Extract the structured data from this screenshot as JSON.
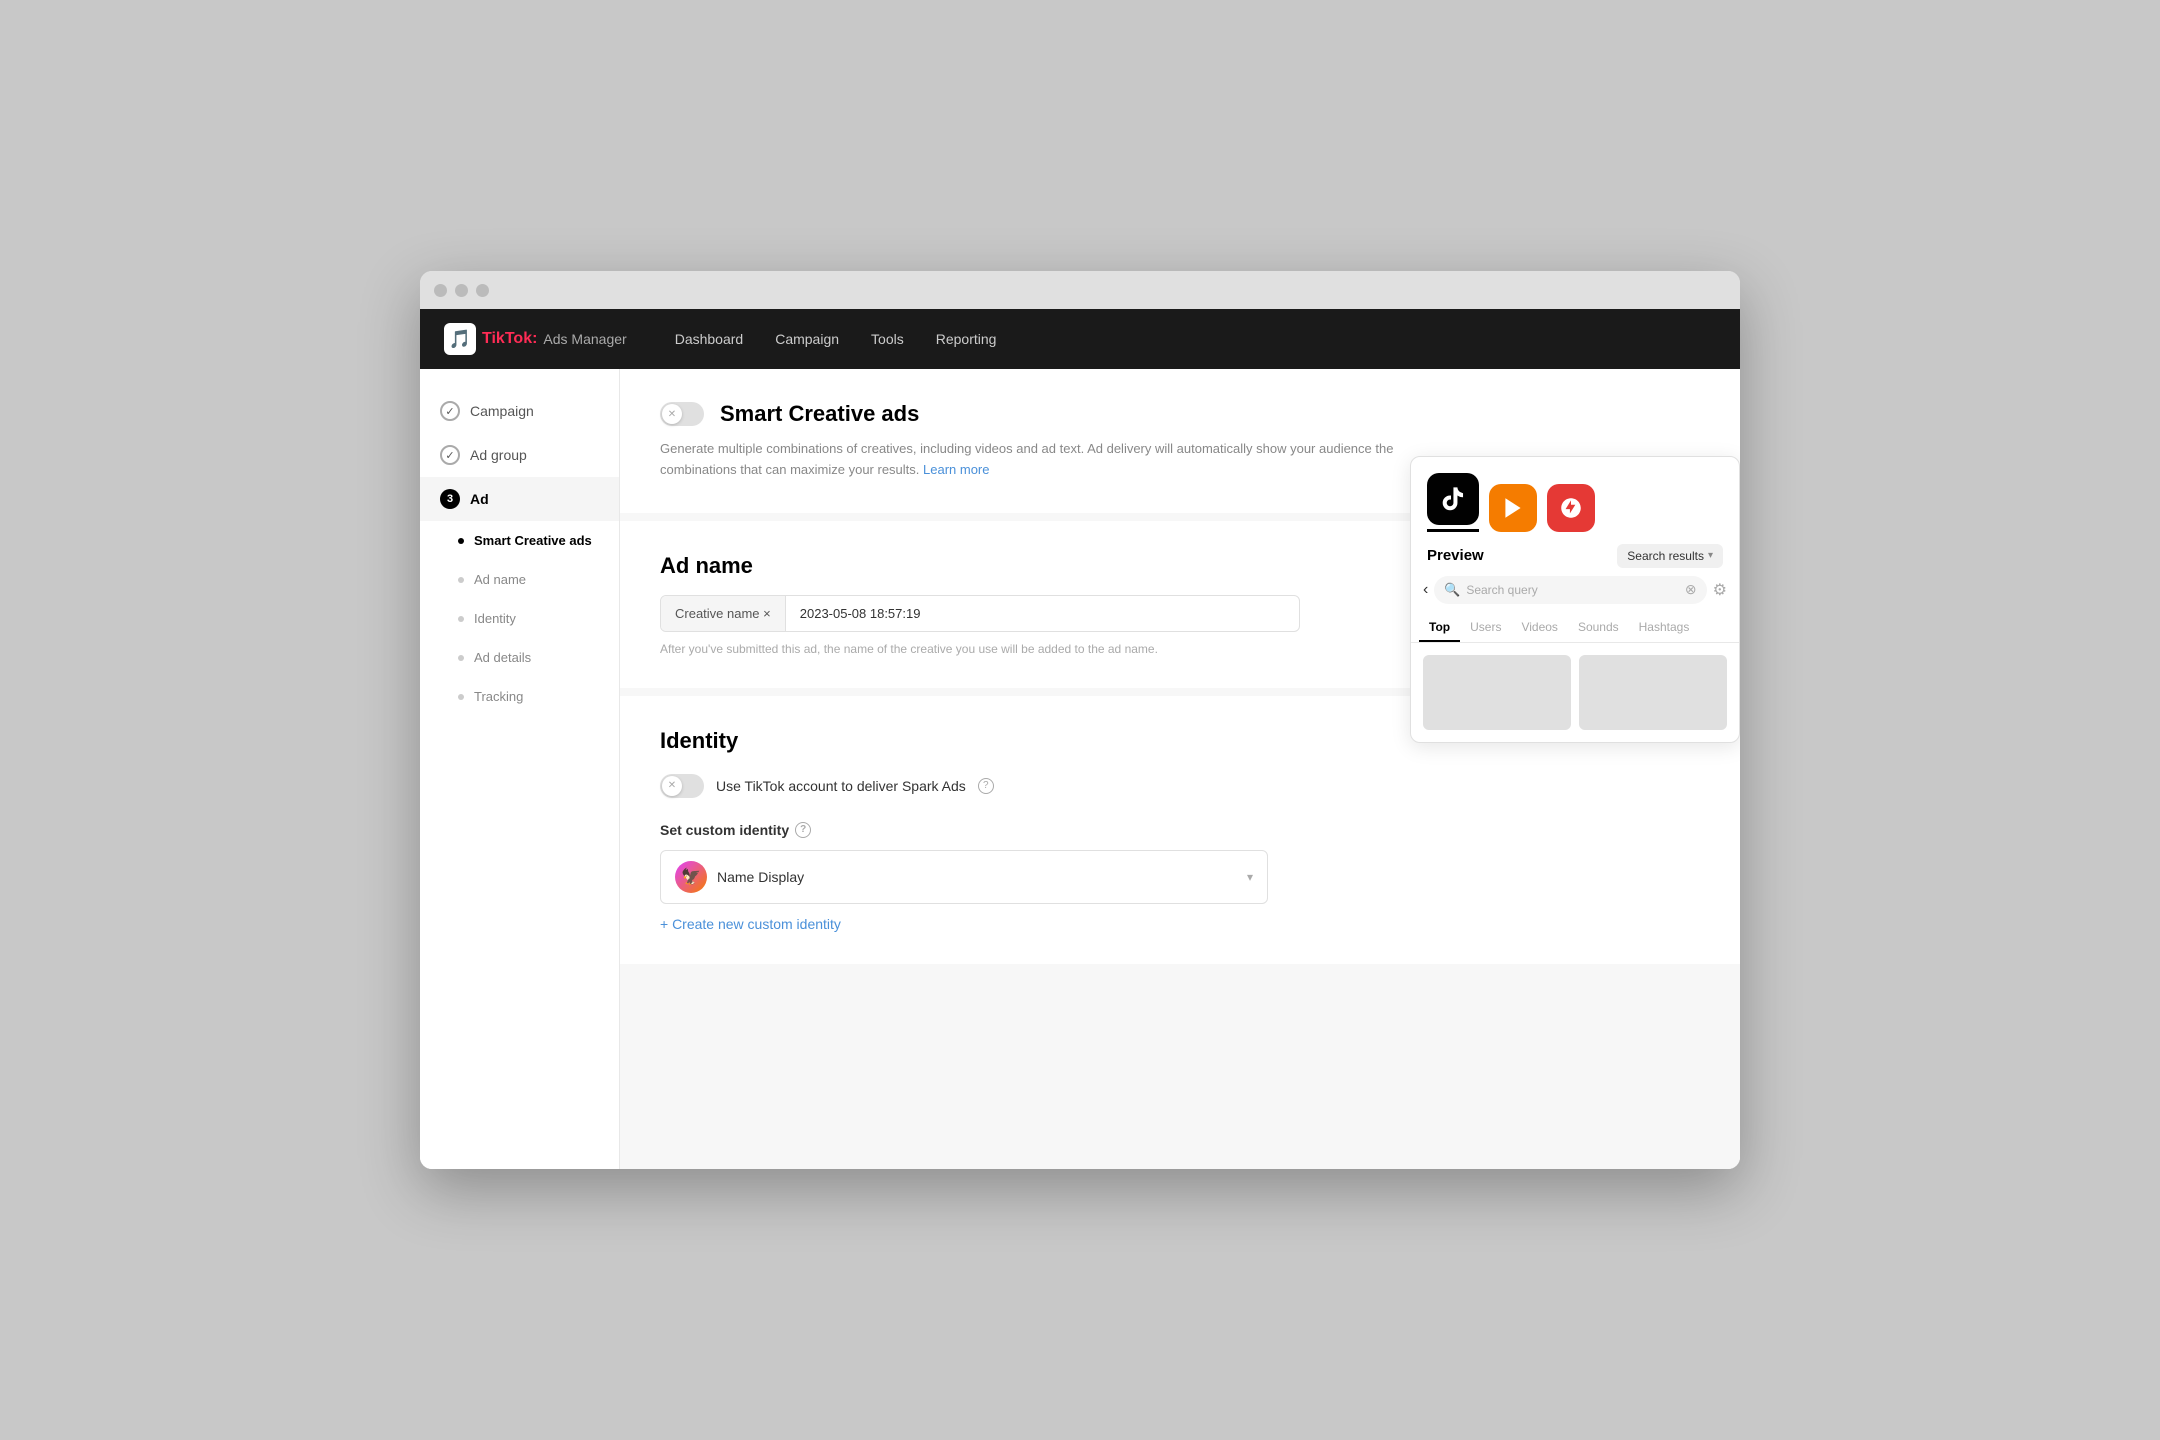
{
  "window": {
    "title": "TikTok Ads Manager"
  },
  "brand": {
    "name": "TikTok",
    "colon": ":",
    "sub": "Ads Manager"
  },
  "nav": {
    "items": [
      "Dashboard",
      "Campaign",
      "Tools",
      "Reporting"
    ]
  },
  "sidebar": {
    "steps": [
      {
        "id": "campaign",
        "label": "Campaign",
        "type": "check"
      },
      {
        "id": "ad-group",
        "label": "Ad group",
        "type": "check"
      },
      {
        "id": "ad",
        "label": "Ad",
        "type": "number",
        "number": "3"
      }
    ],
    "sub_items": [
      {
        "id": "smart-creative-ads",
        "label": "Smart Creative ads",
        "active": true
      },
      {
        "id": "ad-name",
        "label": "Ad name",
        "active": false
      },
      {
        "id": "identity",
        "label": "Identity",
        "active": false
      },
      {
        "id": "ad-details",
        "label": "Ad details",
        "active": false
      },
      {
        "id": "tracking",
        "label": "Tracking",
        "active": false
      }
    ]
  },
  "smart_creative": {
    "title": "Smart Creative ads",
    "description": "Generate multiple combinations of creatives, including videos and ad text. Ad delivery will automatically show your audience the combinations that can maximize your results.",
    "learn_more": "Learn more"
  },
  "ad_name": {
    "section_title": "Ad name",
    "tag_label": "Creative name ×",
    "value": "2023-05-08 18:57:19",
    "hint": "After you've submitted this ad, the name of the creative you use will be added to the ad name."
  },
  "identity": {
    "section_title": "Identity",
    "spark_ads_label": "Use TikTok account to deliver Spark Ads",
    "custom_identity_label": "Set custom identity",
    "selected_name": "Name Display",
    "create_new": "+ Create new custom identity"
  },
  "preview": {
    "active_tab": "Preview",
    "search_results_tab": "Search results",
    "search_placeholder": "Search query",
    "categories": [
      "Top",
      "Users",
      "Videos",
      "Sounds",
      "Hashtags"
    ],
    "active_category": "Top"
  }
}
